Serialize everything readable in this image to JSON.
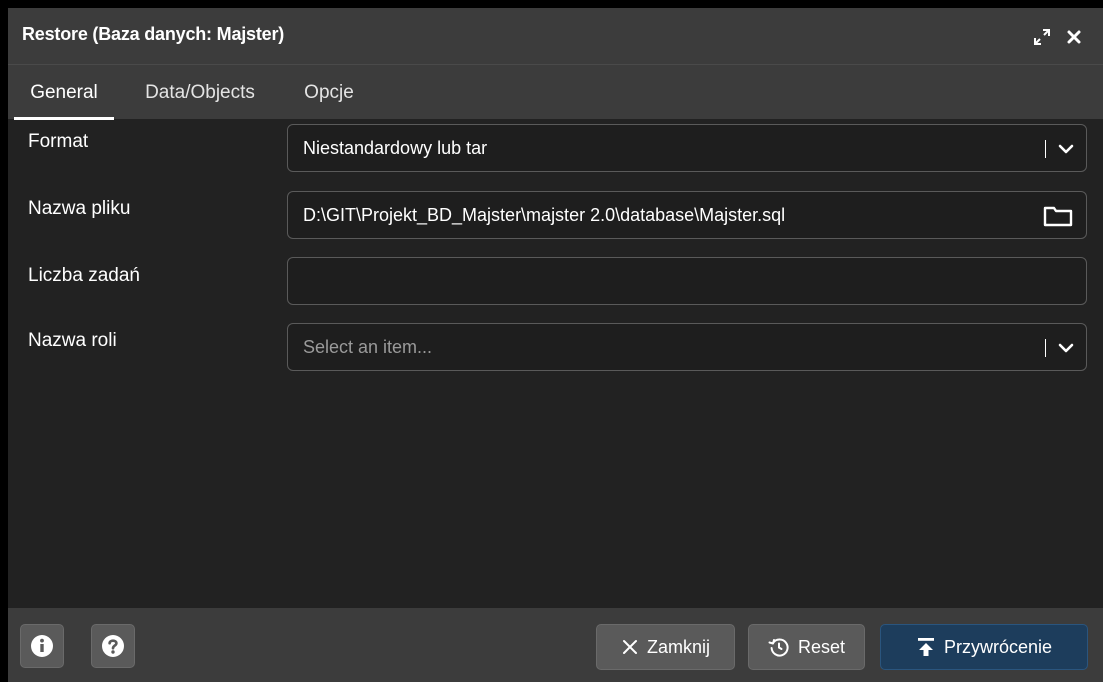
{
  "dialog": {
    "title": "Restore (Baza danych: Majster)"
  },
  "tabs": [
    {
      "label": "General",
      "active": true
    },
    {
      "label": "Data/Objects",
      "active": false
    },
    {
      "label": "Opcje",
      "active": false
    }
  ],
  "form": {
    "format": {
      "label": "Format",
      "value": "Niestandardowy lub tar"
    },
    "filename": {
      "label": "Nazwa pliku",
      "value": "D:\\GIT\\Projekt_BD_Majster\\majster 2.0\\database\\Majster.sql"
    },
    "jobs": {
      "label": "Liczba zadań",
      "value": ""
    },
    "role": {
      "label": "Nazwa roli",
      "placeholder": "Select an item..."
    }
  },
  "footer": {
    "close_label": "Zamknij",
    "reset_label": "Reset",
    "restore_label": "Przywrócenie"
  },
  "colors": {
    "primary_button": "#1d3d5c",
    "panel": "#222222",
    "header": "#3c3c3c"
  }
}
